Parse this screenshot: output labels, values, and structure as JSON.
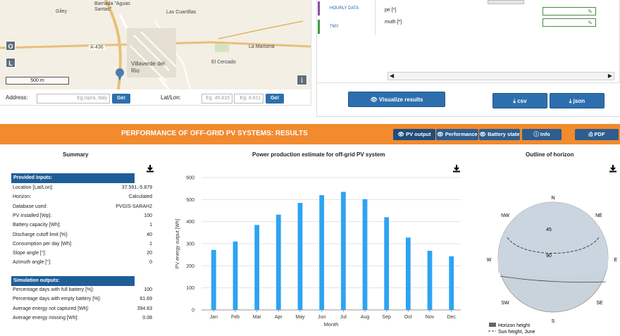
{
  "map": {
    "places": [
      "Giley",
      "Barriada \"Aguas Santas\"",
      "Las Cuartillas",
      "A-436",
      "La Marisma",
      "El Cercado",
      "Villaverde del Rio"
    ],
    "buttons": [
      "O",
      "L"
    ],
    "scale": "500 m",
    "info": "i"
  },
  "address_bar": {
    "address_label": "Address:",
    "address_placeholder": "Eg.Ispra, Italy",
    "go": "Go!",
    "latlon_label": "Lat/Lon:",
    "lat_placeholder": "Eg. 45.815",
    "lon_placeholder": "Eg. 8.611"
  },
  "right_panel": {
    "tabs": [
      "HOURLY DATA",
      "TMY"
    ],
    "fields": [
      {
        "label": "pe [*]",
        "value": ""
      },
      {
        "label": "muth [*]",
        "value": ""
      }
    ],
    "visualize": "Visualize results",
    "csv": "csv",
    "json": "json"
  },
  "results_bar": {
    "title": "PERFORMANCE OF OFF-GRID PV SYSTEMS: RESULTS",
    "tabs": [
      "PV output",
      "Performance",
      "Battery state"
    ],
    "info": "Info",
    "pdf": "PDF"
  },
  "summary": {
    "title": "Summary",
    "inputs_header": "Provided inputs:",
    "inputs": [
      {
        "label": "Location [Lat/Lon]:",
        "value": "37.591,-5.879"
      },
      {
        "label": "Horizon:",
        "value": "Calculated"
      },
      {
        "label": "Database used:",
        "value": "PVGIS-SARAH2"
      },
      {
        "label": "PV installed [Wp]:",
        "value": "100"
      },
      {
        "label": "Battery capacity [Wh]:",
        "value": "1"
      },
      {
        "label": "Discharge cutoff limit [%]:",
        "value": "40"
      },
      {
        "label": "Consumption per day [Wh]:",
        "value": "1"
      },
      {
        "label": "Slope angle [°]:",
        "value": "20"
      },
      {
        "label": "Azimuth angle [°]:",
        "value": "0"
      }
    ],
    "outputs_header": "Simulation outputs:",
    "outputs": [
      {
        "label": "Percentage days with full battery [%]:",
        "value": "100"
      },
      {
        "label": "Percentage days with empty battery [%]:",
        "value": "61.69"
      },
      {
        "label": "Average energy not captured [Wh]:",
        "value": "394.63"
      },
      {
        "label": "Average energy missing [Wh]:",
        "value": "0.08"
      }
    ]
  },
  "chart_data": {
    "type": "bar",
    "title": "Power production estimate for off-grid PV system",
    "xlabel": "Month",
    "ylabel": "PV energy output [Wh]",
    "categories": [
      "Jan",
      "Feb",
      "Mar",
      "Apr",
      "May",
      "Jun",
      "Jul",
      "Aug",
      "Sep",
      "Oct",
      "Nov",
      "Dec"
    ],
    "values": [
      272,
      310,
      385,
      432,
      485,
      520,
      535,
      502,
      420,
      328,
      268,
      243
    ],
    "ylim": [
      0,
      600
    ],
    "yticks": [
      0,
      100,
      200,
      300,
      400,
      500,
      600
    ],
    "grid": true,
    "color": "#2ea3f2"
  },
  "horizon": {
    "title": "Outline of horizon",
    "directions": [
      "N",
      "NE",
      "E",
      "SE",
      "S",
      "SW",
      "W",
      "NW"
    ],
    "rings": [
      "45",
      "90"
    ],
    "legend": [
      "Horizon height",
      "Sun height, June"
    ]
  },
  "colors": {
    "accent": "#f28a2e",
    "primary": "#2d6fae",
    "table_header": "#1e5e98"
  }
}
